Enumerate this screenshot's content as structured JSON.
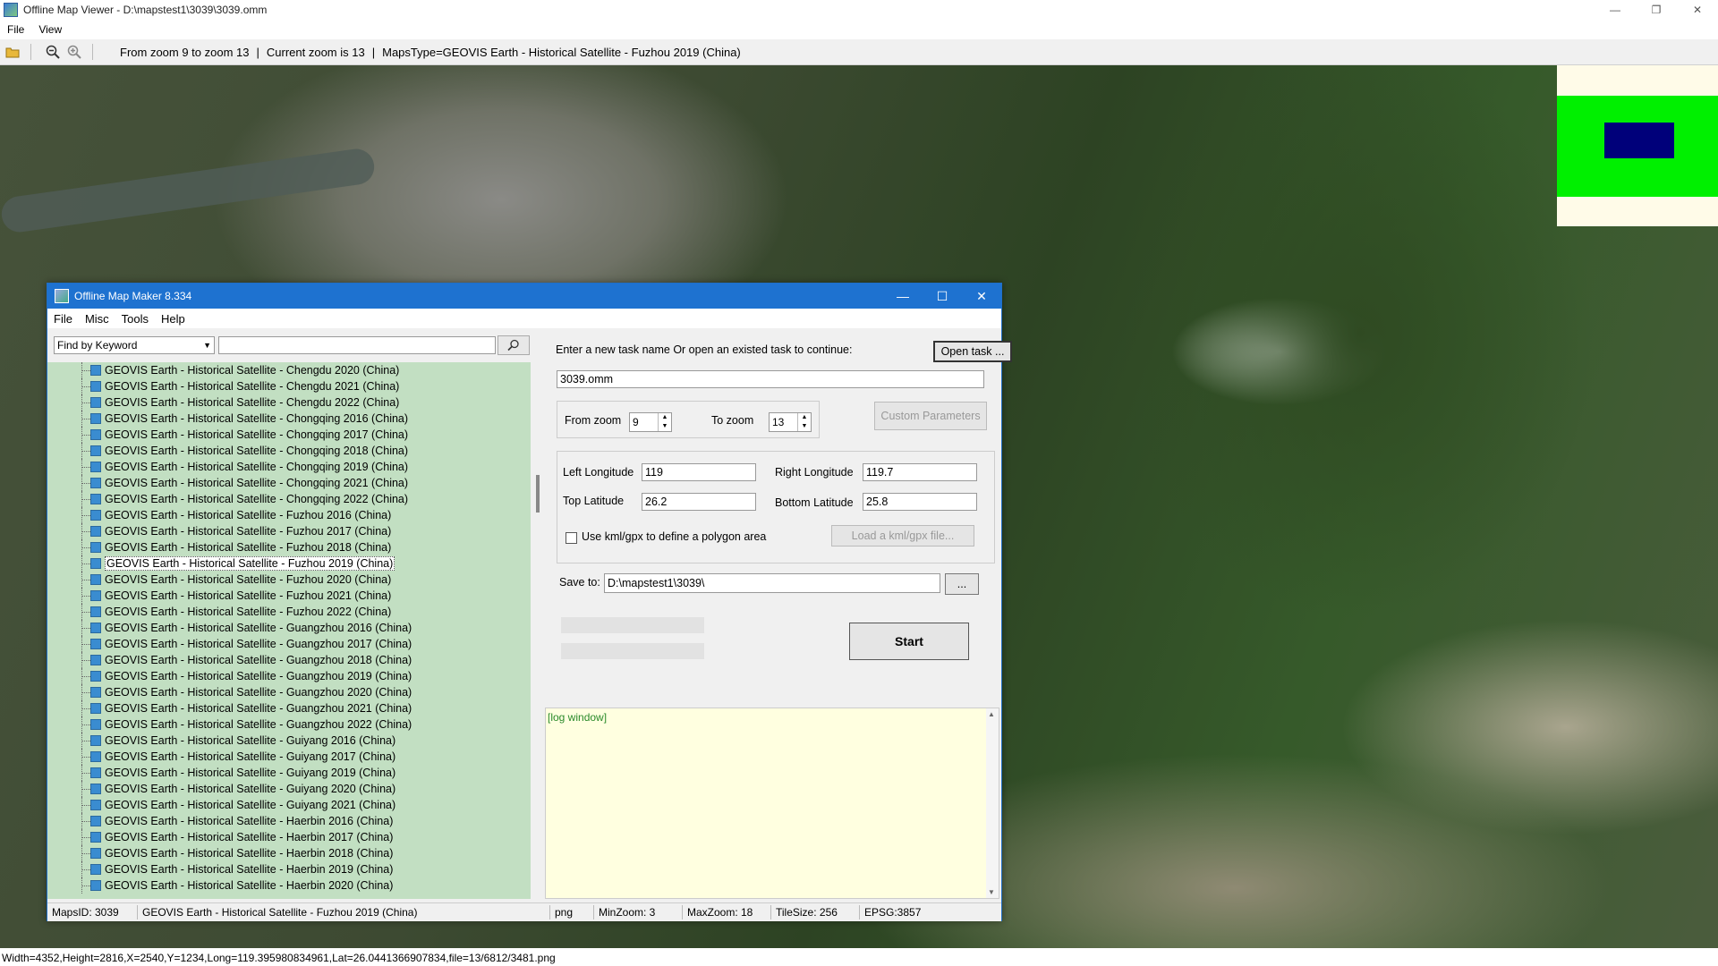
{
  "viewer": {
    "title": "Offline Map Viewer - D:\\mapstest1\\3039\\3039.omm",
    "menu": [
      "File",
      "View"
    ],
    "toolbar": {
      "zoom_range": "From zoom 9 to zoom 13",
      "sep1": "|",
      "current_zoom": "Current zoom is 13",
      "sep2": "|",
      "maps_type": "MapsType=GEOVIS Earth - Historical Satellite - Fuzhou 2019 (China)"
    },
    "statusbar": "Width=4352,Height=2816,X=2540,Y=1234,Long=119.395980834961,Lat=26.0441366907834,file=13/6812/3481.png",
    "window_controls": {
      "minimize": "—",
      "restore": "❐",
      "close": "✕"
    }
  },
  "maker": {
    "title": "Offline Map Maker 8.334",
    "menu": [
      "File",
      "Misc",
      "Tools",
      "Help"
    ],
    "find_mode": "Find by Keyword",
    "search_value": "",
    "tree_items": [
      "GEOVIS Earth - Historical Satellite - Chengdu 2020 (China)",
      "GEOVIS Earth - Historical Satellite - Chengdu 2021 (China)",
      "GEOVIS Earth - Historical Satellite - Chengdu 2022 (China)",
      "GEOVIS Earth - Historical Satellite - Chongqing 2016 (China)",
      "GEOVIS Earth - Historical Satellite - Chongqing 2017 (China)",
      "GEOVIS Earth - Historical Satellite - Chongqing 2018 (China)",
      "GEOVIS Earth - Historical Satellite - Chongqing 2019 (China)",
      "GEOVIS Earth - Historical Satellite - Chongqing 2021 (China)",
      "GEOVIS Earth - Historical Satellite - Chongqing 2022 (China)",
      "GEOVIS Earth - Historical Satellite - Fuzhou 2016 (China)",
      "GEOVIS Earth - Historical Satellite - Fuzhou 2017 (China)",
      "GEOVIS Earth - Historical Satellite - Fuzhou 2018 (China)",
      "GEOVIS Earth - Historical Satellite - Fuzhou 2019 (China)",
      "GEOVIS Earth - Historical Satellite - Fuzhou 2020 (China)",
      "GEOVIS Earth - Historical Satellite - Fuzhou 2021 (China)",
      "GEOVIS Earth - Historical Satellite - Fuzhou 2022 (China)",
      "GEOVIS Earth - Historical Satellite - Guangzhou 2016 (China)",
      "GEOVIS Earth - Historical Satellite - Guangzhou 2017 (China)",
      "GEOVIS Earth - Historical Satellite - Guangzhou 2018 (China)",
      "GEOVIS Earth - Historical Satellite - Guangzhou 2019 (China)",
      "GEOVIS Earth - Historical Satellite - Guangzhou 2020 (China)",
      "GEOVIS Earth - Historical Satellite - Guangzhou 2021 (China)",
      "GEOVIS Earth - Historical Satellite - Guangzhou 2022 (China)",
      "GEOVIS Earth - Historical Satellite - Guiyang 2016 (China)",
      "GEOVIS Earth - Historical Satellite - Guiyang 2017 (China)",
      "GEOVIS Earth - Historical Satellite - Guiyang 2019 (China)",
      "GEOVIS Earth - Historical Satellite - Guiyang 2020 (China)",
      "GEOVIS Earth - Historical Satellite - Guiyang 2021 (China)",
      "GEOVIS Earth - Historical Satellite - Haerbin 2016 (China)",
      "GEOVIS Earth - Historical Satellite - Haerbin 2017 (China)",
      "GEOVIS Earth - Historical Satellite - Haerbin 2018 (China)",
      "GEOVIS Earth - Historical Satellite - Haerbin 2019 (China)",
      "GEOVIS Earth - Historical Satellite - Haerbin 2020 (China)"
    ],
    "selected_index": 12,
    "task_prompt": "Enter a new task name Or open an existed task to continue:",
    "open_task_label": "Open task ...",
    "task_name": "3039.omm",
    "from_zoom_label": "From zoom",
    "from_zoom": "9",
    "to_zoom_label": "To zoom",
    "to_zoom": "13",
    "custom_params_label": "Custom Parameters",
    "left_lon_label": "Left Longitude",
    "left_lon": "119",
    "right_lon_label": "Right Longitude",
    "right_lon": "119.7",
    "top_lat_label": "Top Latitude",
    "top_lat": "26.2",
    "bottom_lat_label": "Bottom Latitude",
    "bottom_lat": "25.8",
    "kml_check_label": "Use kml/gpx to define a polygon area",
    "kml_checked": false,
    "load_kml_label": "Load a kml/gpx file...",
    "save_to_label": "Save to:",
    "save_to": "D:\\mapstest1\\3039\\",
    "browse_label": "...",
    "start_label": "Start",
    "log_text": "[log window]",
    "status": {
      "maps_id": "MapsID: 3039",
      "maps_name": "GEOVIS Earth - Historical Satellite - Fuzhou 2019 (China)",
      "format": "png",
      "min_zoom": "MinZoom: 3",
      "max_zoom": "MaxZoom: 18",
      "tile_size": "TileSize: 256",
      "epsg": "EPSG:3857"
    },
    "window_controls": {
      "minimize": "—",
      "maximize": "☐",
      "close": "✕"
    }
  },
  "colors": {
    "title_blue": "#1e72d0",
    "tree_bg": "#c2dfc2",
    "log_bg": "#ffffe0",
    "overview_green": "#00f000",
    "overview_box": "#00007a"
  }
}
